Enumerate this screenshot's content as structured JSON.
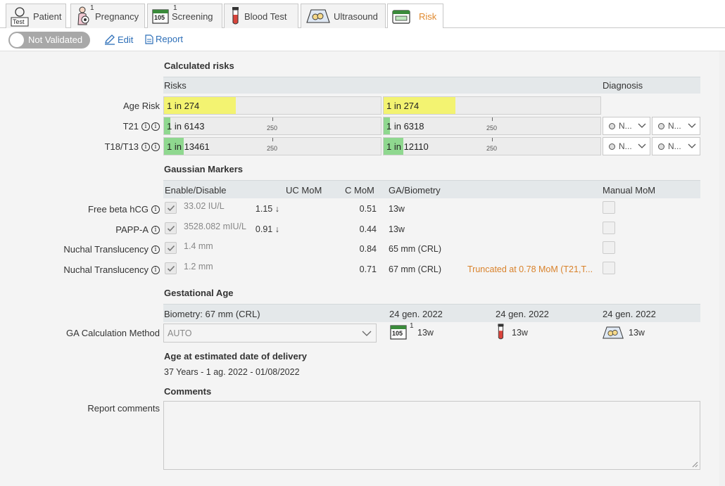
{
  "tabs": [
    {
      "label": "Patient",
      "icon": "patient-icon",
      "badge": "Test"
    },
    {
      "label": "Pregnancy",
      "icon": "pregnancy-icon",
      "count": "1"
    },
    {
      "label": "Screening",
      "icon": "calendar-icon",
      "count": "1",
      "badge": "105"
    },
    {
      "label": "Blood Test",
      "icon": "test-tube-icon"
    },
    {
      "label": "Ultrasound",
      "icon": "ultrasound-icon"
    },
    {
      "label": "Risk",
      "icon": "risk-icon",
      "active": true
    }
  ],
  "toolbar": {
    "validation_label": "Not Validated",
    "edit_label": "Edit",
    "report_label": "Report"
  },
  "calculated_risks": {
    "title": "Calculated risks",
    "header_risks": "Risks",
    "header_diagnosis": "Diagnosis",
    "tick_label": "250",
    "rows": [
      {
        "label": "Age Risk",
        "left": "1 in 274",
        "right": "1 in 274",
        "left_fill": 0.33,
        "right_fill": 0.33,
        "fill_color": "#f3f371"
      },
      {
        "label": "T21",
        "left": "1 in 6143",
        "right": "1 in 6318",
        "left_fill": 0.03,
        "right_fill": 0.03,
        "fill_color": "#8fd88f",
        "diag1": "N...",
        "diag2": "N..."
      },
      {
        "label": "T18/T13",
        "left": "1 in 13461",
        "right": "1 in 12110",
        "left_fill": 0.09,
        "right_fill": 0.09,
        "fill_color": "#8fd88f",
        "diag1": "N...",
        "diag2": "N..."
      }
    ]
  },
  "gaussian": {
    "title": "Gaussian Markers",
    "headers": {
      "enable": "Enable/Disable",
      "uc": "UC MoM",
      "c": "C MoM",
      "ga": "GA/Biometry",
      "manual": "Manual MoM"
    },
    "rows": [
      {
        "label": "Free beta hCG",
        "value": "33.02 IU/L",
        "uc": "1.15",
        "uc_arrow": "↓",
        "c": "0.51",
        "ga": "13w",
        "warn": ""
      },
      {
        "label": "PAPP-A",
        "value": "3528.082 mIU/L",
        "uc": "0.91",
        "uc_arrow": "↓",
        "c": "0.44",
        "ga": "13w",
        "warn": ""
      },
      {
        "label": "Nuchal Translucency",
        "value": "1.4 mm",
        "uc": "",
        "uc_arrow": "",
        "c": "0.84",
        "ga": "65 mm (CRL)",
        "warn": ""
      },
      {
        "label": "Nuchal Translucency",
        "value": "1.2 mm",
        "uc": "",
        "uc_arrow": "",
        "c": "0.71",
        "ga": "67 mm (CRL)",
        "warn": "Truncated at 0.78 MoM (T21,T..."
      }
    ]
  },
  "gestational": {
    "title": "Gestational Age",
    "header_biometry": "Biometry: 67 mm (CRL)",
    "dates": [
      "24 gen. 2022",
      "24 gen. 2022",
      "24 gen. 2022"
    ],
    "method_label": "GA Calculation Method",
    "method_value": "AUTO",
    "weeks": [
      "13w",
      "13w",
      "13w"
    ],
    "screening_count": "1",
    "screening_badge": "105"
  },
  "age_delivery": {
    "title": "Age at estimated date of delivery",
    "value": "37 Years - 1 ag. 2022 - 01/08/2022"
  },
  "comments": {
    "title": "Comments",
    "label": "Report comments",
    "value": ""
  }
}
